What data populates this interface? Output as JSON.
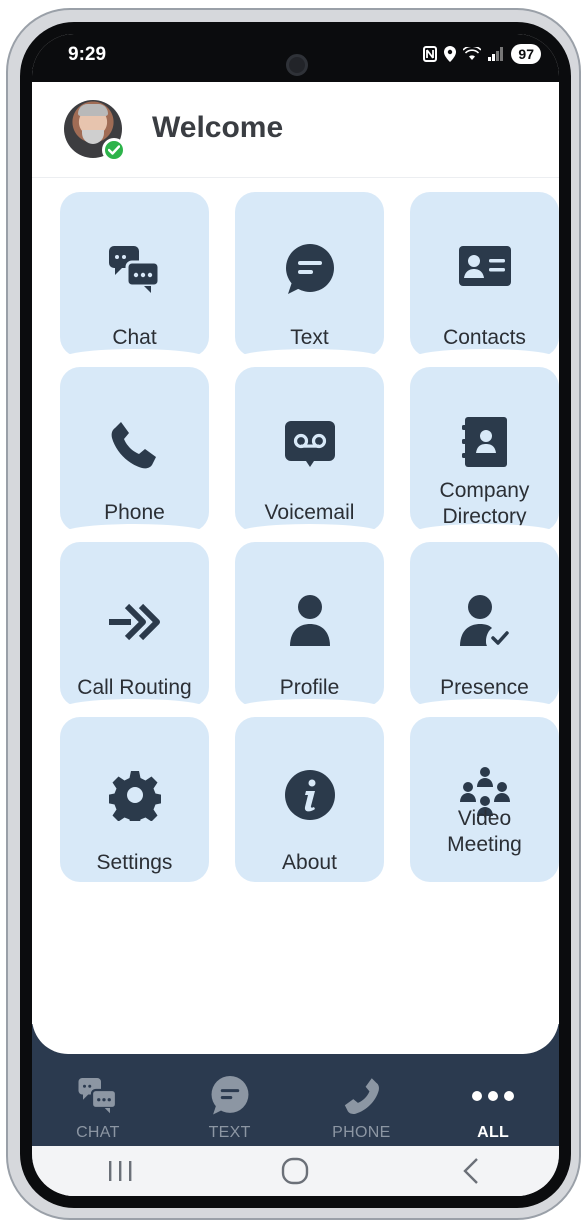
{
  "status_bar": {
    "time": "9:29",
    "battery": "97",
    "icons": [
      "nfc-icon",
      "location-icon",
      "wifi-icon",
      "signal-icon",
      "battery-icon"
    ]
  },
  "header": {
    "title": "Welcome",
    "presence_status_icon": "check-icon",
    "presence_color": "#2db34a"
  },
  "tiles": [
    {
      "label": "Chat",
      "icon": "chat-bubbles-icon"
    },
    {
      "label": "Text",
      "icon": "text-message-icon"
    },
    {
      "label": "Contacts",
      "icon": "contact-card-icon"
    },
    {
      "label": "Phone",
      "icon": "phone-icon"
    },
    {
      "label": "Voicemail",
      "icon": "voicemail-icon"
    },
    {
      "label_line1": "Company",
      "label_line2": "Directory",
      "icon": "directory-book-icon"
    },
    {
      "label": "Call Routing",
      "icon": "call-routing-icon"
    },
    {
      "label": "Profile",
      "icon": "person-icon"
    },
    {
      "label": "Presence",
      "icon": "person-check-icon"
    },
    {
      "label": "Settings",
      "icon": "gear-icon"
    },
    {
      "label": "About",
      "icon": "info-icon"
    },
    {
      "label_line1": "Video",
      "label_line2": "Meeting",
      "icon": "group-meeting-icon"
    }
  ],
  "bottom_nav": [
    {
      "label": "CHAT",
      "icon": "chat-bubbles-icon",
      "active": false
    },
    {
      "label": "TEXT",
      "icon": "text-message-icon",
      "active": false
    },
    {
      "label": "PHONE",
      "icon": "phone-icon",
      "active": false
    },
    {
      "label": "ALL",
      "icon": "more-dots-icon",
      "active": true
    }
  ],
  "system_nav": [
    "recents-icon",
    "home-icon",
    "back-icon"
  ],
  "colors": {
    "tile_bg": "#d8e9f8",
    "icon_dark": "#2b3a4b",
    "nav_bg": "#2b3a4f",
    "nav_inactive": "#8c96a3",
    "nav_active": "#ffffff"
  }
}
